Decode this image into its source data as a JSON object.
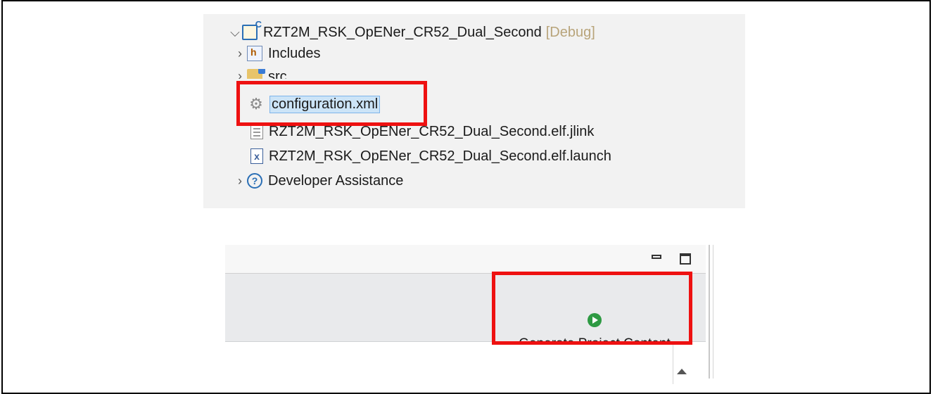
{
  "explorer": {
    "project": {
      "name": "RZT2M_RSK_OpENer_CR52_Dual_Second",
      "config": "[Debug]"
    },
    "items": [
      {
        "label": "Includes",
        "icon": "includes-folder-icon",
        "expandable": true
      },
      {
        "label": "src",
        "icon": "source-folder-icon",
        "expandable": true
      },
      {
        "label": "configuration.xml",
        "icon": "gear-icon",
        "expandable": false,
        "selected": true
      },
      {
        "label": "RZT2M_RSK_OpENer_CR52_Dual_Second.elf.jlink",
        "icon": "text-file-icon",
        "expandable": false
      },
      {
        "label": "RZT2M_RSK_OpENer_CR52_Dual_Second.elf.launch",
        "icon": "launch-file-icon",
        "expandable": false
      },
      {
        "label": "Developer Assistance",
        "icon": "help-icon",
        "expandable": true
      }
    ]
  },
  "editor": {
    "generate_button": {
      "label": "Generate Project Content",
      "icon": "play-icon"
    }
  },
  "colors": {
    "highlight": "#ee1111",
    "selection": "#cce4f7",
    "play": "#2e9a43"
  }
}
